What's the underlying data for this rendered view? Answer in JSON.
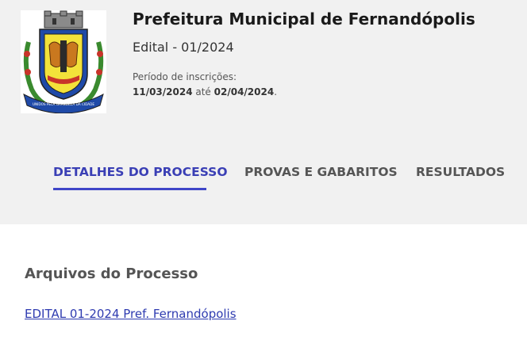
{
  "header": {
    "org_name": "Prefeitura Municipal de Fernandópolis",
    "edital": "Edital - 01/2024",
    "periodo_label": "Período de inscrições:",
    "periodo_start": "11/03/2024",
    "periodo_sep": " até ",
    "periodo_end": "02/04/2024",
    "periodo_end_punct": ".",
    "crest_motto": "UNIDOS PELA GRANDEZA DA CIDADE"
  },
  "tabs": [
    {
      "label": "DETALHES DO PROCESSO",
      "active": true
    },
    {
      "label": "PROVAS E GABARITOS",
      "active": false
    },
    {
      "label": "RESULTADOS",
      "active": false
    }
  ],
  "main": {
    "section_title": "Arquivos do Processo",
    "files": [
      {
        "label": "EDITAL 01-2024 Pref. Fernandópolis"
      }
    ]
  },
  "colors": {
    "header_bg": "#f1f1f1",
    "accent": "#3f46c8",
    "link": "#2e3bb0"
  }
}
